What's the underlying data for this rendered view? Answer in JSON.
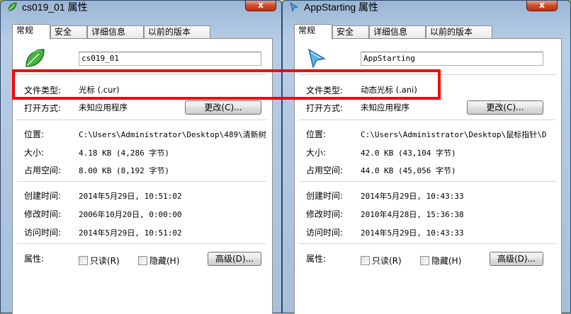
{
  "left": {
    "title": "cs019_01 属性",
    "close_label": "x",
    "tabs": [
      {
        "label": "常规"
      },
      {
        "label": "安全"
      },
      {
        "label": "详细信息"
      },
      {
        "label": "以前的版本"
      }
    ],
    "file_name": "cs019_01",
    "file_type_label": "文件类型:",
    "file_type_value": "光标 (.cur)",
    "open_with_label": "打开方式:",
    "open_with_value": "未知应用程序",
    "change_button": "更改(C)...",
    "location_label": "位置:",
    "location_value": "C:\\Users\\Administrator\\Desktop\\489\\清新树",
    "size_label": "大小:",
    "size_value": "4.18 KB (4,286 字节)",
    "disk_size_label": "占用空间:",
    "disk_size_value": "8.00 KB (8,192 字节)",
    "created_label": "创建时间:",
    "created_value": "2014年5月29日, 10:51:02",
    "modified_label": "修改时间:",
    "modified_value": "2006年10月20日, 0:00:00",
    "accessed_label": "访问时间:",
    "accessed_value": "2014年5月29日, 10:51:02",
    "attributes_label": "属性:",
    "readonly_label": "只读(R)",
    "hidden_label": "隐藏(H)",
    "advanced_button": "高级(D)..."
  },
  "right": {
    "title": "AppStarting 属性",
    "close_label": "x",
    "tabs": [
      {
        "label": "常规"
      },
      {
        "label": "安全"
      },
      {
        "label": "详细信息"
      },
      {
        "label": "以前的版本"
      }
    ],
    "file_name": "AppStarting",
    "file_type_label": "文件类型:",
    "file_type_value": "动态光标 (.ani)",
    "open_with_label": "打开方式:",
    "open_with_value": "未知应用程序",
    "change_button": "更改(C)...",
    "location_label": "位置:",
    "location_value": "C:\\Users\\Administrator\\Desktop\\鼠标指针\\D",
    "size_label": "大小:",
    "size_value": "42.0 KB (43,104 字节)",
    "disk_size_label": "占用空间:",
    "disk_size_value": "44.0 KB (45,056 字节)",
    "created_label": "创建时间:",
    "created_value": "2014年5月29日, 10:43:33",
    "modified_label": "修改时间:",
    "modified_value": "2010年4月28日, 15:36:38",
    "accessed_label": "访问时间:",
    "accessed_value": "2014年5月29日, 10:43:33",
    "attributes_label": "属性:",
    "readonly_label": "只读(R)",
    "hidden_label": "隐藏(H)",
    "advanced_button": "高级(D)..."
  },
  "colors": {
    "highlight": "#ff0000",
    "close_button": "#cf4a2a",
    "window_frame": "#a9c2de"
  }
}
